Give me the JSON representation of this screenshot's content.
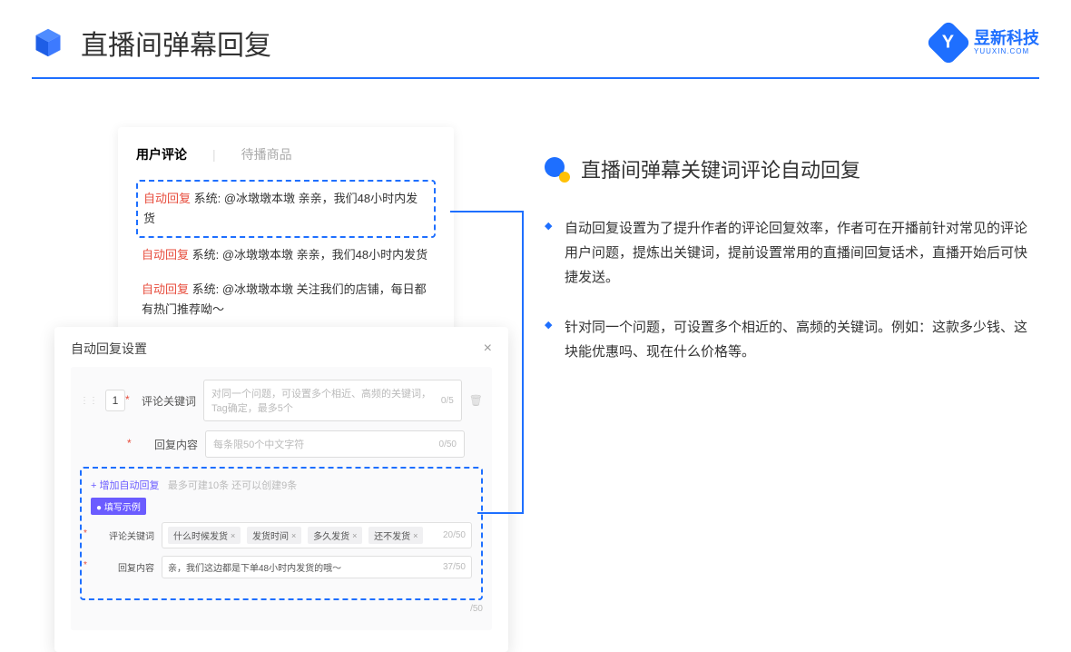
{
  "header": {
    "title": "直播间弹幕回复",
    "brand_name": "昱新科技",
    "brand_url": "YUUXIN.COM"
  },
  "comments_card": {
    "tab_active": "用户评论",
    "tab_inactive": "待播商品",
    "rows": [
      {
        "tag": "自动回复",
        "text": " 系统: @冰墩墩本墩 亲亲，我们48小时内发货"
      },
      {
        "tag": "自动回复",
        "text": " 系统: @冰墩墩本墩 亲亲，我们48小时内发货"
      },
      {
        "tag": "自动回复",
        "text": " 系统: @冰墩墩本墩 关注我们的店铺，每日都有热门推荐呦～"
      }
    ]
  },
  "settings_card": {
    "title": "自动回复设置",
    "index": "1",
    "keyword_label": "评论关键词",
    "keyword_placeholder": "对同一个问题，可设置多个相近、高频的关键词，Tag确定，最多5个",
    "keyword_counter": "0/5",
    "content_label": "回复内容",
    "content_placeholder": "每条限50个中文字符",
    "content_counter": "0/50",
    "add_link": "+ 增加自动回复",
    "add_hint": "最多可建10条 还可以创建9条",
    "example_badge": "● 填写示例",
    "ex_keyword_label": "评论关键词",
    "tags": [
      "什么时候发货",
      "发货时间",
      "多久发货",
      "还不发货"
    ],
    "ex_kw_counter": "20/50",
    "ex_content_label": "回复内容",
    "ex_content_value": "亲，我们这边都是下单48小时内发货的哦～",
    "ex_content_counter": "37/50",
    "outer_counter": "/50"
  },
  "right": {
    "title": "直播间弹幕关键词评论自动回复",
    "paras": [
      "自动回复设置为了提升作者的评论回复效率，作者可在开播前针对常见的评论用户问题，提炼出关键词，提前设置常用的直播间回复话术，直播开始后可快捷发送。",
      "针对同一个问题，可设置多个相近的、高频的关键词。例如：这款多少钱、这块能优惠吗、现在什么价格等。"
    ]
  }
}
